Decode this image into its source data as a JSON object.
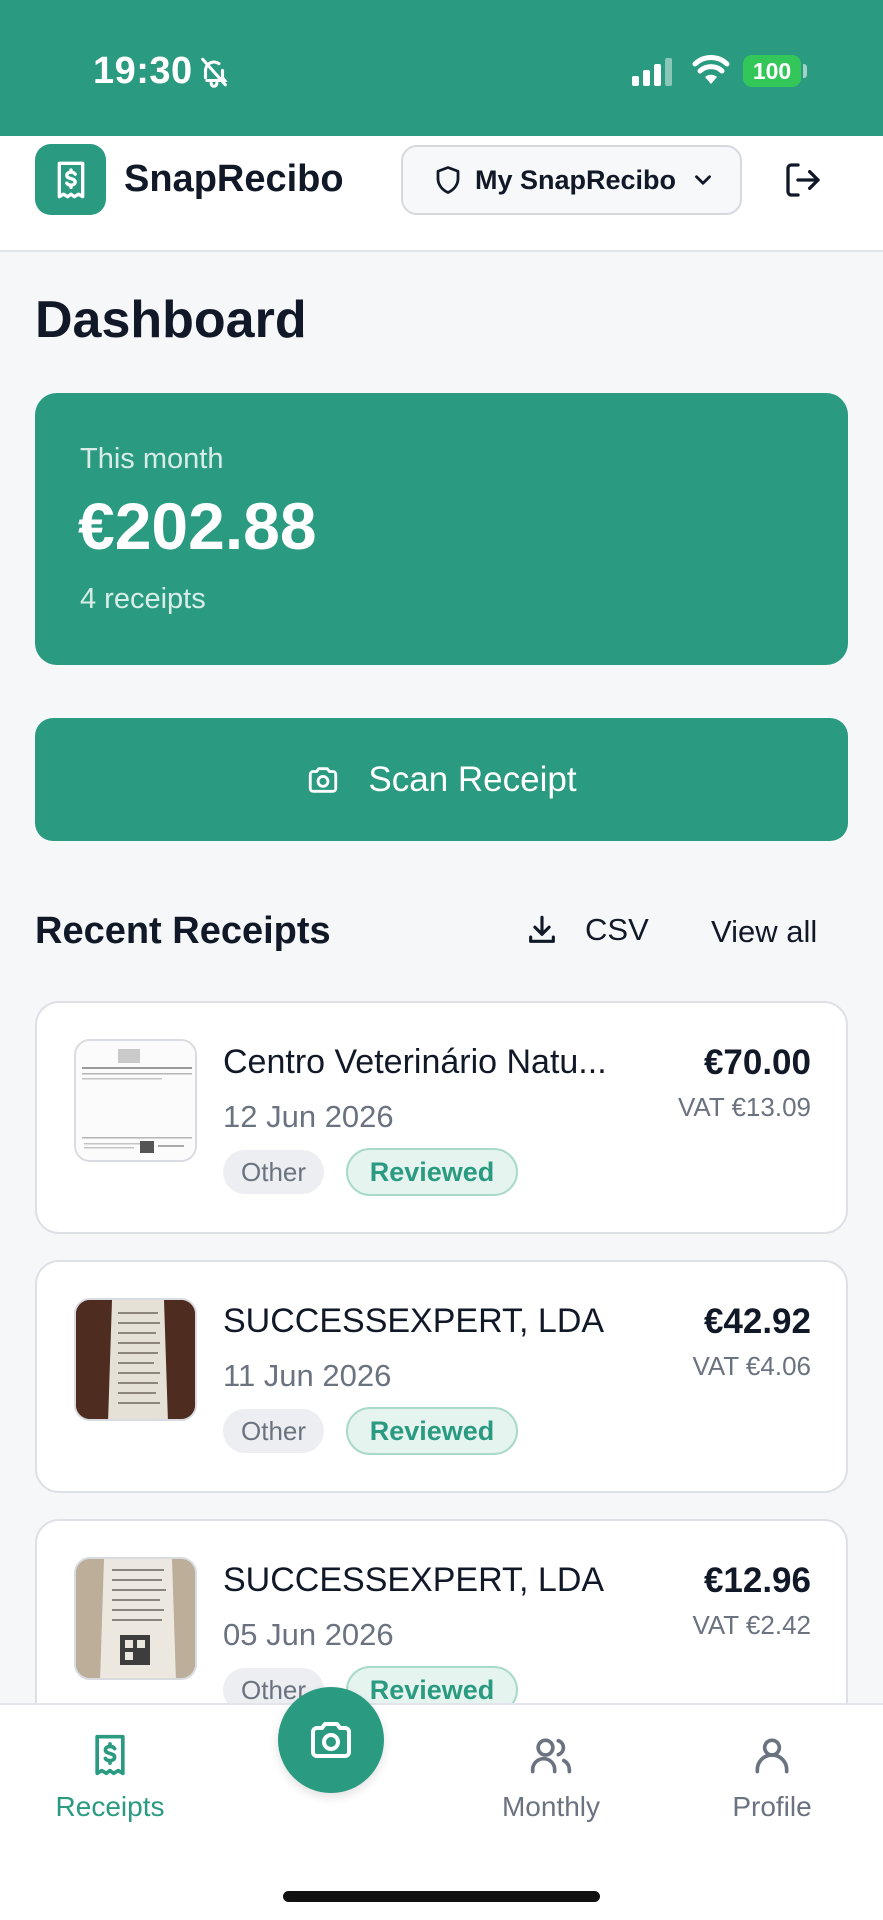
{
  "status_bar": {
    "time": "19:30",
    "battery": "100"
  },
  "app_bar": {
    "brand": "SnapRecibo",
    "workspace": "My SnapRecibo"
  },
  "page": {
    "title": "Dashboard"
  },
  "summary": {
    "label": "This month",
    "amount": "€202.88",
    "count": "4 receipts"
  },
  "scan_button": {
    "label": "Scan Receipt"
  },
  "recent": {
    "title": "Recent Receipts",
    "csv_label": "CSV",
    "view_all": "View all",
    "receipts": [
      {
        "merchant": "Centro Veterinário Natu...",
        "date": "12 Jun 2026",
        "amount": "€70.00",
        "vat": "VAT €13.09",
        "category": "Other",
        "status": "Reviewed"
      },
      {
        "merchant": "SUCCESSEXPERT, LDA",
        "date": "11 Jun 2026",
        "amount": "€42.92",
        "vat": "VAT €4.06",
        "category": "Other",
        "status": "Reviewed"
      },
      {
        "merchant": "SUCCESSEXPERT, LDA",
        "date": "05 Jun 2026",
        "amount": "€12.96",
        "vat": "VAT €2.42",
        "category": "Other",
        "status": "Reviewed"
      }
    ]
  },
  "tab_bar": {
    "receipts": "Receipts",
    "monthly": "Monthly",
    "profile": "Profile"
  },
  "colors": {
    "accent": "#2a9a80",
    "status_bar": "#2a9a80",
    "battery": "#33c759",
    "reviewed_tag_bg": "#e5f4ef"
  }
}
